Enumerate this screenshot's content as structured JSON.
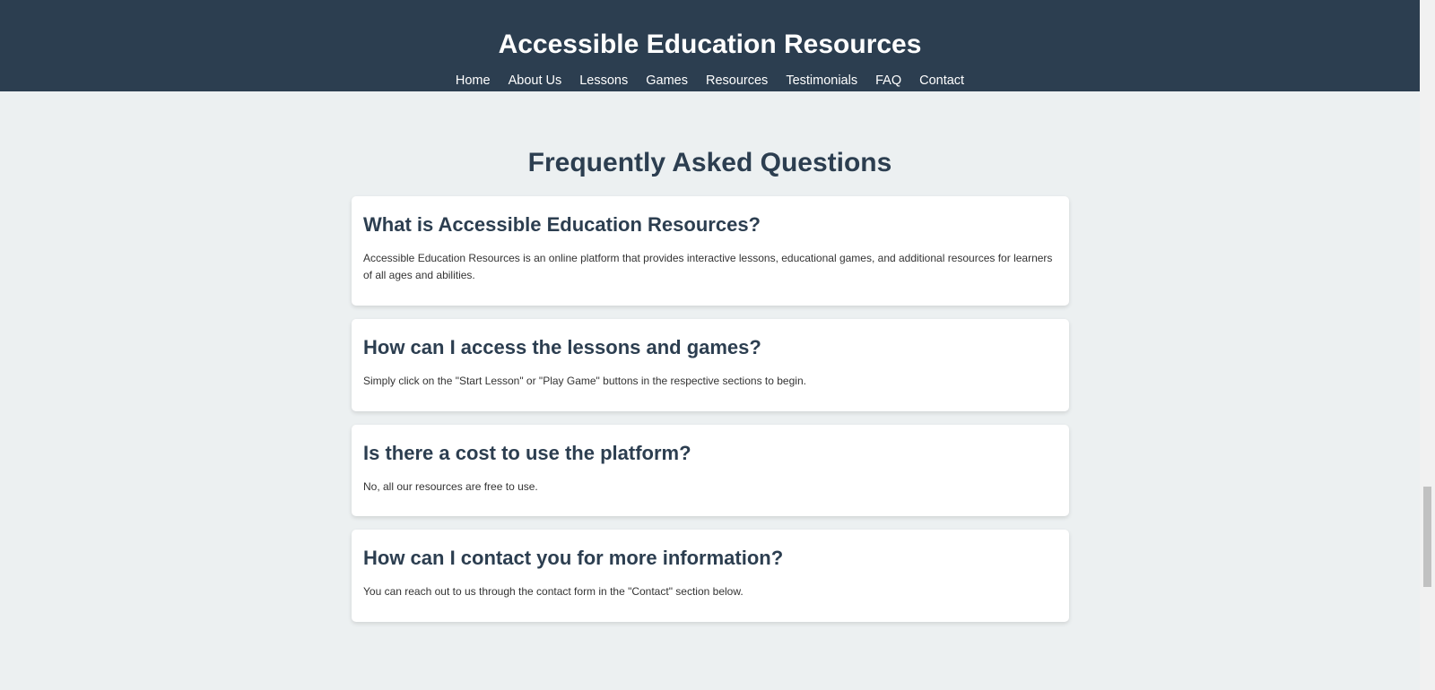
{
  "header": {
    "title": "Accessible Education Resources",
    "nav": [
      {
        "label": "Home"
      },
      {
        "label": "About Us"
      },
      {
        "label": "Lessons"
      },
      {
        "label": "Games"
      },
      {
        "label": "Resources"
      },
      {
        "label": "Testimonials"
      },
      {
        "label": "FAQ"
      },
      {
        "label": "Contact"
      }
    ]
  },
  "faq": {
    "title": "Frequently Asked Questions",
    "items": [
      {
        "question": "What is Accessible Education Resources?",
        "answer": "Accessible Education Resources is an online platform that provides interactive lessons, educational games, and additional resources for learners of all ages and abilities."
      },
      {
        "question": "How can I access the lessons and games?",
        "answer": "Simply click on the \"Start Lesson\" or \"Play Game\" buttons in the respective sections to begin."
      },
      {
        "question": "Is there a cost to use the platform?",
        "answer": "No, all our resources are free to use."
      },
      {
        "question": "How can I contact you for more information?",
        "answer": "You can reach out to us through the contact form in the \"Contact\" section below."
      }
    ]
  },
  "colors": {
    "header_bg": "#2c3e50",
    "page_bg": "#ecf0f1",
    "card_bg": "#ffffff",
    "heading": "#2c3e50"
  }
}
